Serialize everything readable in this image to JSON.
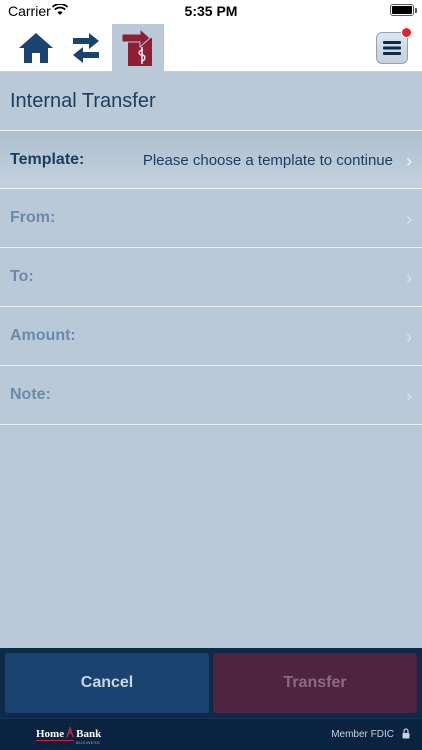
{
  "status_bar": {
    "carrier": "Carrier",
    "time": "5:35 PM"
  },
  "toolbar": {
    "icons": [
      "home-icon",
      "swap-arrows-icon",
      "transfer-document-icon",
      "menu-icon"
    ],
    "active_tab": "transfer",
    "badge_color": "#e0242c"
  },
  "page": {
    "title": "Internal Transfer"
  },
  "form": {
    "rows": [
      {
        "label": "Template:",
        "value": "Please choose a template to continue"
      },
      {
        "label": "From:",
        "value": ""
      },
      {
        "label": "To:",
        "value": ""
      },
      {
        "label": "Amount:",
        "value": ""
      },
      {
        "label": "Note:",
        "value": ""
      }
    ]
  },
  "actions": {
    "cancel_label": "Cancel",
    "transfer_label": "Transfer"
  },
  "footer": {
    "logo_left": "Home",
    "logo_mid": "Bank",
    "logo_sub": "BUSINESS",
    "fdic": "Member FDIC"
  },
  "colors": {
    "background": "#b9c9d8",
    "navy": "#0d2b49",
    "accent_blue": "#1b4370",
    "accent_maroon": "#4f2440",
    "brand_red": "#c3263c"
  }
}
